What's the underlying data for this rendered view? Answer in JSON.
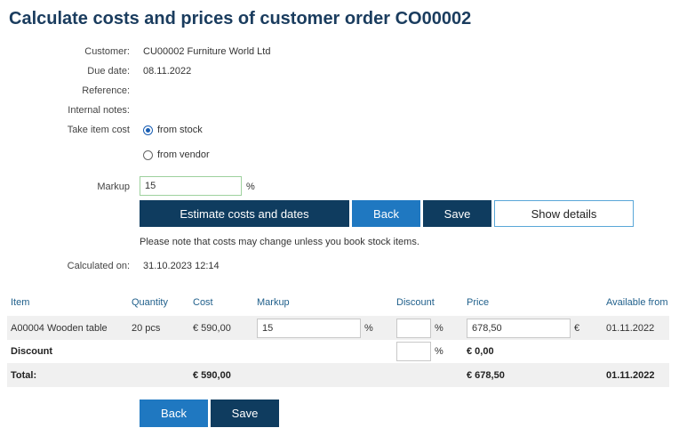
{
  "page": {
    "title": "Calculate costs and prices of customer order CO00002"
  },
  "form": {
    "customer_label": "Customer:",
    "customer_value": "CU00002 Furniture World Ltd",
    "due_date_label": "Due date:",
    "due_date_value": "08.11.2022",
    "reference_label": "Reference:",
    "reference_value": "",
    "internal_notes_label": "Internal notes:",
    "internal_notes_value": "",
    "take_item_cost_label": "Take item cost",
    "options": [
      "from stock",
      "from vendor"
    ],
    "selected_option": "from stock",
    "markup_label": "Markup",
    "markup_value": "15",
    "markup_unit": "%"
  },
  "actions": {
    "estimate_label": "Estimate costs and dates",
    "back_label": "Back",
    "save_label": "Save",
    "show_details_label": "Show details"
  },
  "note": "Please note that costs may change unless you book stock items.",
  "calculated": {
    "label": "Calculated on:",
    "value": "31.10.2023 12:14"
  },
  "table": {
    "headers": [
      "Item",
      "Quantity",
      "Cost",
      "Markup",
      "Discount",
      "Price",
      "Available from"
    ],
    "rows": [
      {
        "item": "A00004 Wooden table",
        "quantity": "20 pcs",
        "cost": "€ 590,00",
        "markup": "15",
        "markup_unit": "%",
        "discount": "",
        "discount_unit": "%",
        "price": "678,50",
        "price_unit": "€",
        "available_from": "01.11.2022"
      }
    ],
    "discount_row": {
      "label": "Discount",
      "discount": "",
      "discount_unit": "%",
      "price": "€ 0,00"
    },
    "total_row": {
      "label": "Total:",
      "cost": "€ 590,00",
      "price": "€ 678,50",
      "available_from": "01.11.2022"
    }
  },
  "footer": {
    "back_label": "Back",
    "save_label": "Save"
  },
  "colors": {
    "title": "#1a3c5e",
    "primary_dark": "#0f3c5f",
    "primary_blue": "#1f78c1",
    "header_text": "#1f5f8b",
    "row_bg": "#f0f0f0"
  }
}
